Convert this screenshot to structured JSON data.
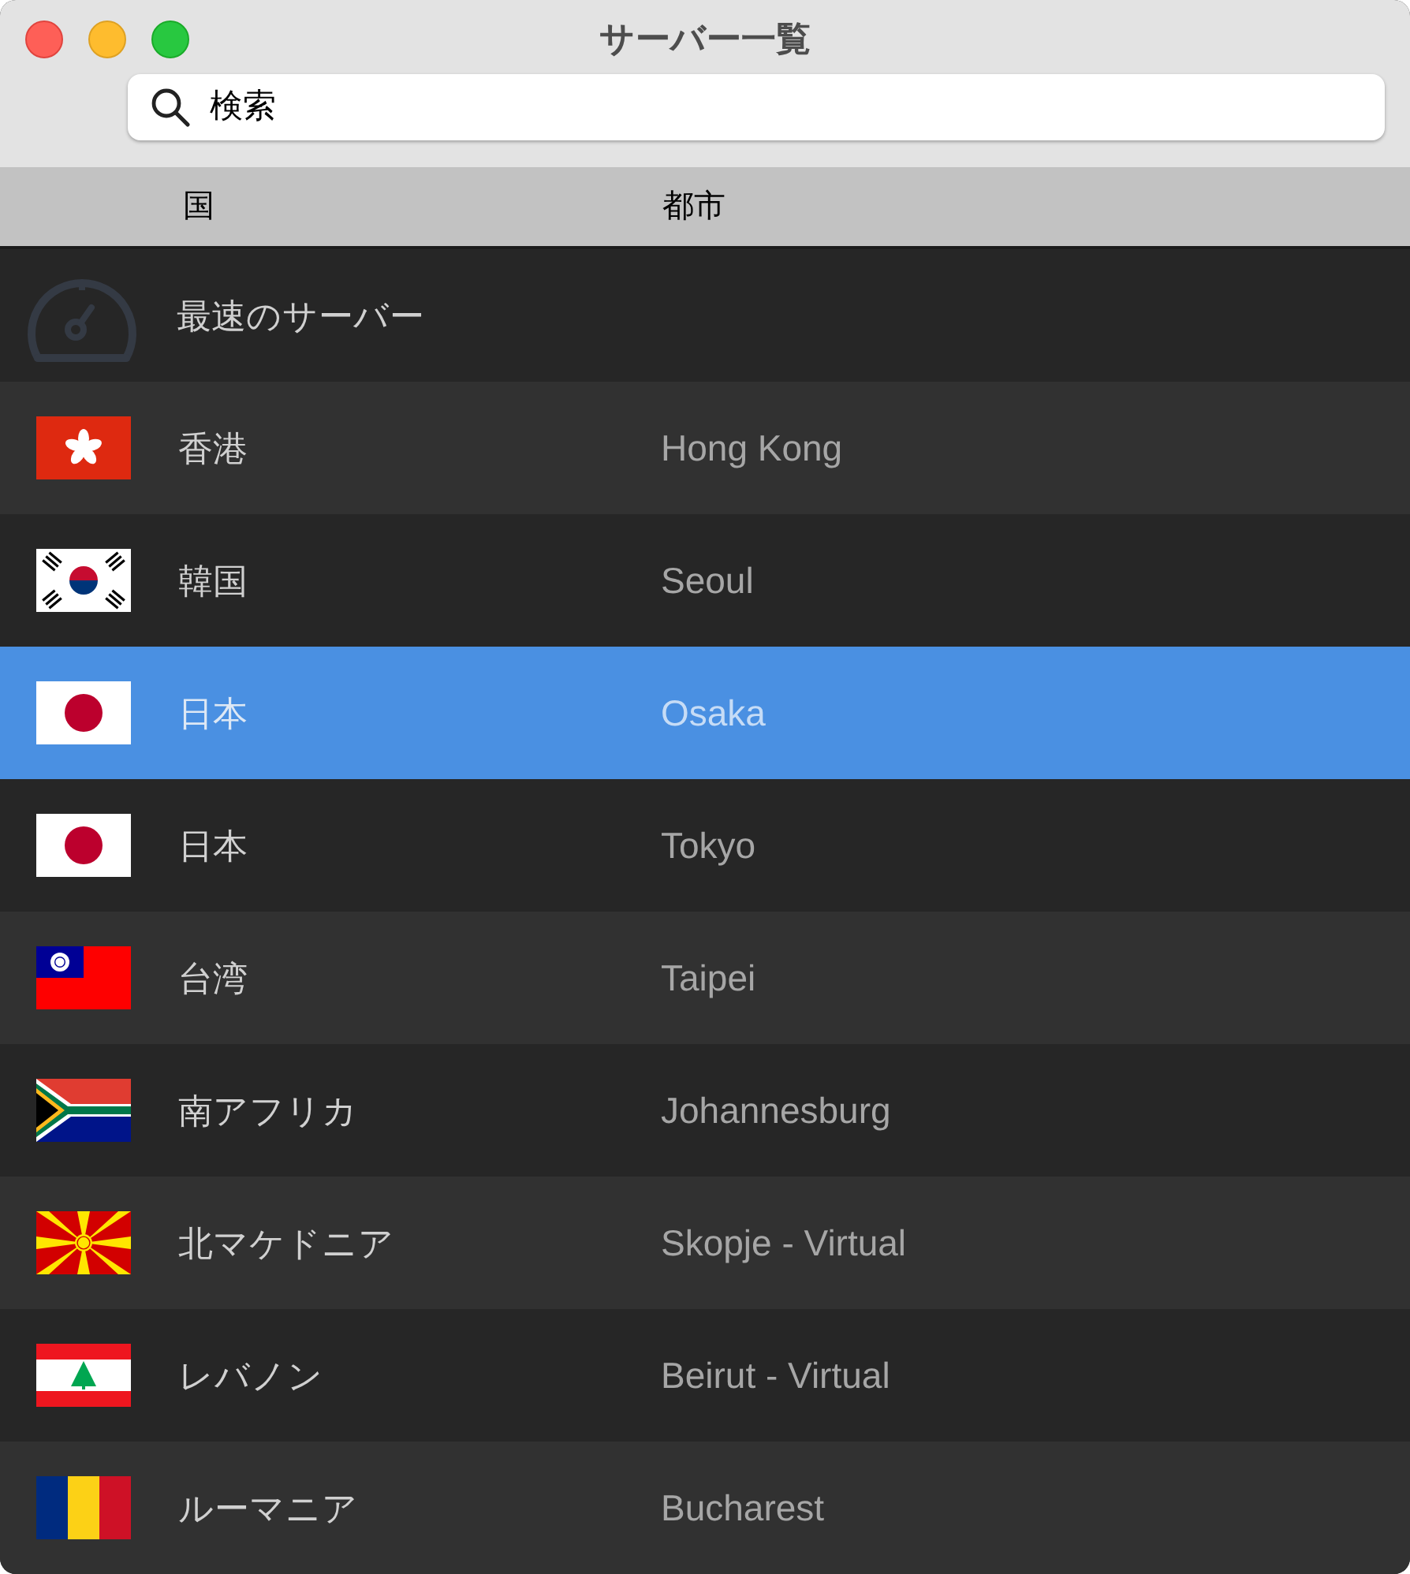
{
  "window": {
    "title": "サーバー一覧"
  },
  "search": {
    "placeholder": "検索"
  },
  "table": {
    "columns": [
      "国",
      "都市"
    ],
    "rows": [
      {
        "kind": "fastest",
        "country": "最速のサーバー",
        "selected": false
      },
      {
        "kind": "hk",
        "country": "香港",
        "city": "Hong Kong",
        "selected": false
      },
      {
        "kind": "kr",
        "country": "韓国",
        "city": "Seoul",
        "selected": false
      },
      {
        "kind": "jp",
        "country": "日本",
        "city": "Osaka",
        "selected": true
      },
      {
        "kind": "jp",
        "country": "日本",
        "city": "Tokyo",
        "selected": false
      },
      {
        "kind": "tw",
        "country": "台湾",
        "city": "Taipei",
        "selected": false
      },
      {
        "kind": "za",
        "country": "南アフリカ",
        "city": "Johannesburg",
        "selected": false
      },
      {
        "kind": "mk",
        "country": "北マケドニア",
        "city": "Skopje - Virtual",
        "selected": false
      },
      {
        "kind": "lb",
        "country": "レバノン",
        "city": "Beirut - Virtual",
        "selected": false
      },
      {
        "kind": "ro",
        "country": "ルーマニア",
        "city": "Bucharest",
        "selected": false
      }
    ]
  }
}
